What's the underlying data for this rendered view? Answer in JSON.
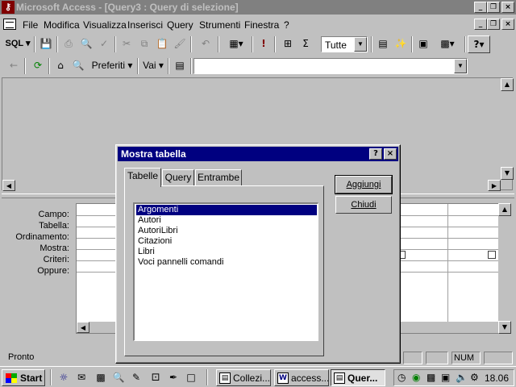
{
  "window": {
    "title": "Microsoft Access - [Query3 : Query di selezione]",
    "app_icon": "access-key-icon"
  },
  "menu": [
    {
      "label": "File"
    },
    {
      "label": "Modifica"
    },
    {
      "label": "Visualizza"
    },
    {
      "label": "Inserisci"
    },
    {
      "label": "Query"
    },
    {
      "label": "Strumenti"
    },
    {
      "label": "Finestra"
    },
    {
      "label": "?"
    }
  ],
  "toolbar": {
    "sql_label": "SQL",
    "query_type_combo": "Tutte"
  },
  "web_toolbar": {
    "favorites_label": "Preferiti",
    "goto_label": "Vai",
    "address_value": ""
  },
  "query_grid": {
    "row_labels": [
      "Campo:",
      "Tabella:",
      "Ordinamento:",
      "Mostra:",
      "Criteri:",
      "Oppure:"
    ]
  },
  "status": {
    "text": "Pronto",
    "num_indicator": "NUM"
  },
  "dialog": {
    "title": "Mostra tabella",
    "tabs": [
      "Tabelle",
      "Query",
      "Entrambe"
    ],
    "active_tab": "Tabelle",
    "items": [
      "Argomenti",
      "Autori",
      "AutoriLibri",
      "Citazioni",
      "Libri",
      "Voci pannelli comandi"
    ],
    "selected_item": "Argomenti",
    "add_button": "Aggiungi",
    "close_button": "Chiudi"
  },
  "taskbar": {
    "start_label": "Start",
    "tasks": [
      {
        "label": "Collezi..."
      },
      {
        "label": "access..."
      },
      {
        "label": "Quer..."
      }
    ],
    "clock": "18.06"
  },
  "colors": {
    "dialog_titlebar": "#000080",
    "inactive_titlebar": "#808080",
    "selection": "#000080",
    "face": "#c0c0c0"
  }
}
